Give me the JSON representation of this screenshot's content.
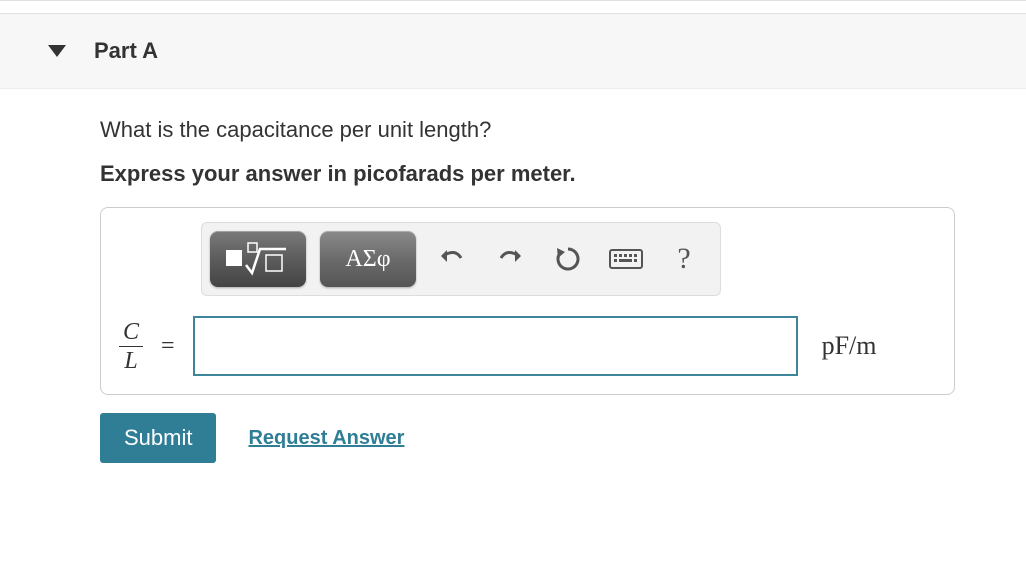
{
  "part": {
    "label": "Part A"
  },
  "question": "What is the capacitance per unit length?",
  "instruction": "Express your answer in picofarads per meter.",
  "toolbar": {
    "templates_label": "templates",
    "symbols_label": "ΑΣφ",
    "undo_label": "undo",
    "redo_label": "redo",
    "reset_label": "reset",
    "keyboard_label": "keyboard",
    "help_label": "?"
  },
  "expression": {
    "numerator": "C",
    "denominator": "L",
    "equals": "="
  },
  "input": {
    "value": "",
    "unit": "pF/m"
  },
  "actions": {
    "submit": "Submit",
    "request": "Request Answer"
  }
}
